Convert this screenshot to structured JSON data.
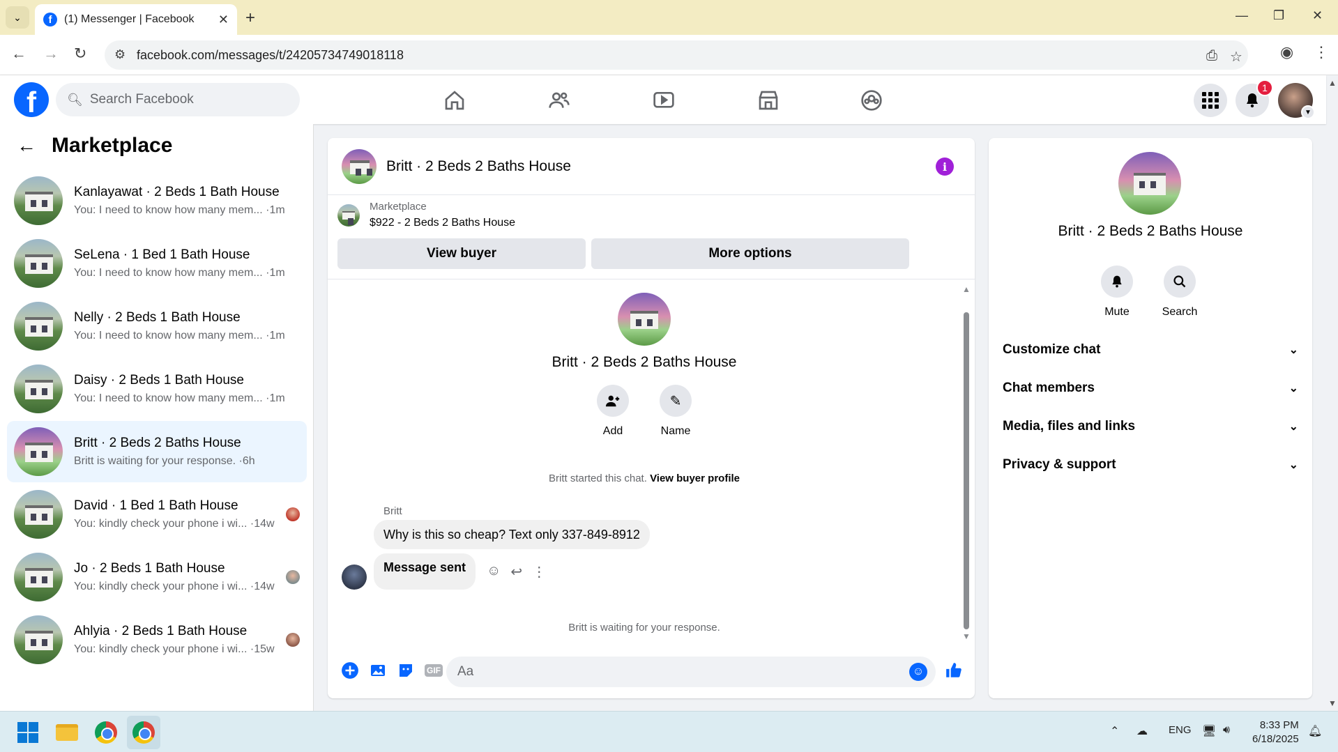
{
  "browser": {
    "tab_title": "(1) Messenger | Facebook",
    "url": "facebook.com/messages/t/24205734749018118"
  },
  "header": {
    "search_placeholder": "Search Facebook",
    "notification_count": "1"
  },
  "sidebar": {
    "title": "Marketplace",
    "conversations": [
      {
        "name": "Kanlayawat · 2 Beds 1 Bath House",
        "preview": "You: I need to know how many mem... ·1m",
        "thumb": "green"
      },
      {
        "name": "SeLena · 1 Bed 1 Bath House",
        "preview": "You: I need to know how many mem... ·1m",
        "thumb": "green"
      },
      {
        "name": "Nelly · 2 Beds 1 Bath House",
        "preview": "You: I need to know how many mem... ·1m",
        "thumb": "green"
      },
      {
        "name": "Daisy · 2 Beds 1 Bath House",
        "preview": "You: I need to know how many mem... ·1m",
        "thumb": "green"
      },
      {
        "name": "Britt · 2 Beds 2 Baths House",
        "preview": "Britt is waiting for your response. ·6h",
        "thumb": "sunset",
        "active": true
      },
      {
        "name": "David · 1 Bed 1 Bath House",
        "preview": "You: kindly check your phone i wi... ·14w",
        "thumb": "green"
      },
      {
        "name": "Jo · 2 Beds 1 Bath House",
        "preview": "You: kindly check your phone i wi... ·14w",
        "thumb": "green"
      },
      {
        "name": "Ahlyia · 2 Beds 1 Bath House",
        "preview": "You: kindly check your phone i wi... ·15w",
        "thumb": "green"
      }
    ]
  },
  "chat": {
    "title": "Britt · 2 Beds 2 Baths House",
    "marketplace_label": "Marketplace",
    "listing": "$922 - 2 Beds 2 Baths House",
    "view_buyer": "View buyer",
    "more_options": "More options",
    "profile_name": "Britt · 2 Beds 2 Baths House",
    "add_label": "Add",
    "name_label": "Name",
    "started_text": "Britt started this chat.",
    "view_buyer_profile": "View buyer profile",
    "sender": "Britt",
    "message_1": "Why is this so cheap? Text only 337-849-8912",
    "message_2": "Message sent",
    "waiting": "Britt is waiting for your response.",
    "composer_placeholder": "Aa"
  },
  "info_panel": {
    "name": "Britt · 2 Beds 2 Baths House",
    "mute": "Mute",
    "search": "Search",
    "sections": [
      "Customize chat",
      "Chat members",
      "Media, files and links",
      "Privacy & support"
    ]
  },
  "taskbar": {
    "lang": "ENG",
    "time": "8:33 PM",
    "date": "6/18/2025"
  },
  "colors": {
    "fb_blue": "#0866ff",
    "active_conv": "#ebf5ff",
    "info_purple": "#a020d8",
    "badge_red": "#e41e3f"
  }
}
